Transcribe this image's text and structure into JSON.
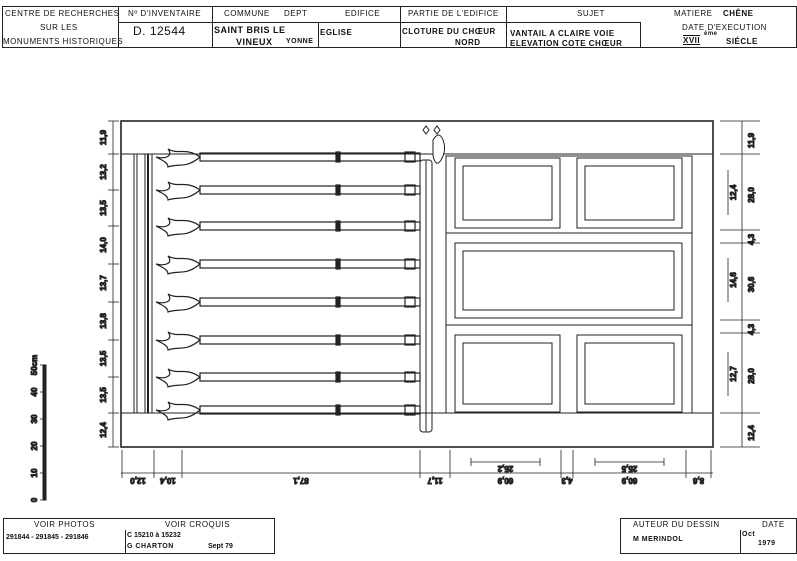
{
  "header": {
    "institution": [
      "CENTRE DE RECHERCHES",
      "SUR LES",
      "MONUMENTS HISTORIQUES"
    ],
    "inventory_label": "Nº D'INVENTAIRE",
    "inventory_value": "D. 12544",
    "commune_label": "COMMUNE",
    "dept_label": "DEPT",
    "commune_value_1": "SAINT BRIS LE",
    "commune_value_2": "VINEUX",
    "dept_value": "YONNE",
    "edifice_label": "EDIFICE",
    "edifice_value": "EGLISE",
    "partie_label": "PARTIE DE L'EDIFICE",
    "partie_value_1": "CLOTURE DU CHŒUR",
    "partie_value_2": "NORD",
    "sujet_label": "SUJET",
    "sujet_value_1": "VANTAIL A CLAIRE VOIE",
    "sujet_value_2": "ELEVATION COTE CHŒUR",
    "matiere_label": "MATIERE",
    "matiere_value": "CHÊNE",
    "date_exec_label": "DATE D'EXECUTION",
    "century": "XVII",
    "century_sup": "ème",
    "century_word": "SIÉCLE"
  },
  "footer": {
    "photos_label": "VOIR PHOTOS",
    "photos_value": "291844 - 291845 - 291846",
    "croquis_label": "VOIR CROQUIS",
    "croquis_value": "C 15210 à 15232",
    "croquis_author": "G CHARTON",
    "croquis_date": "Sept 79",
    "author_label": "AUTEUR DU DESSIN",
    "author_value": "M MERINDOL",
    "date_label": "DATE",
    "date_month": "Oct",
    "date_year": "1979"
  },
  "drawing": {
    "left_dims": [
      "11,9",
      "13,2",
      "13,5",
      "14,0",
      "13,7",
      "13,8",
      "13,5",
      "13,5",
      "12,4"
    ],
    "right_dims": [
      "11,9",
      "28,0",
      "4,3",
      "30,6",
      "4,3",
      "28,0",
      "12,4"
    ],
    "right_inner_dims": [
      "12,4",
      "14,6",
      "12,7"
    ],
    "bottom_dims": [
      "12,0",
      "10,4",
      "87,1",
      "11,7",
      "60,9",
      "4,3",
      "60,9",
      "8,6"
    ],
    "bottom_inner_dims": [
      "25,2",
      "25,5"
    ],
    "scale_labels": [
      "0",
      "10",
      "20",
      "30",
      "40",
      "50cm"
    ]
  }
}
